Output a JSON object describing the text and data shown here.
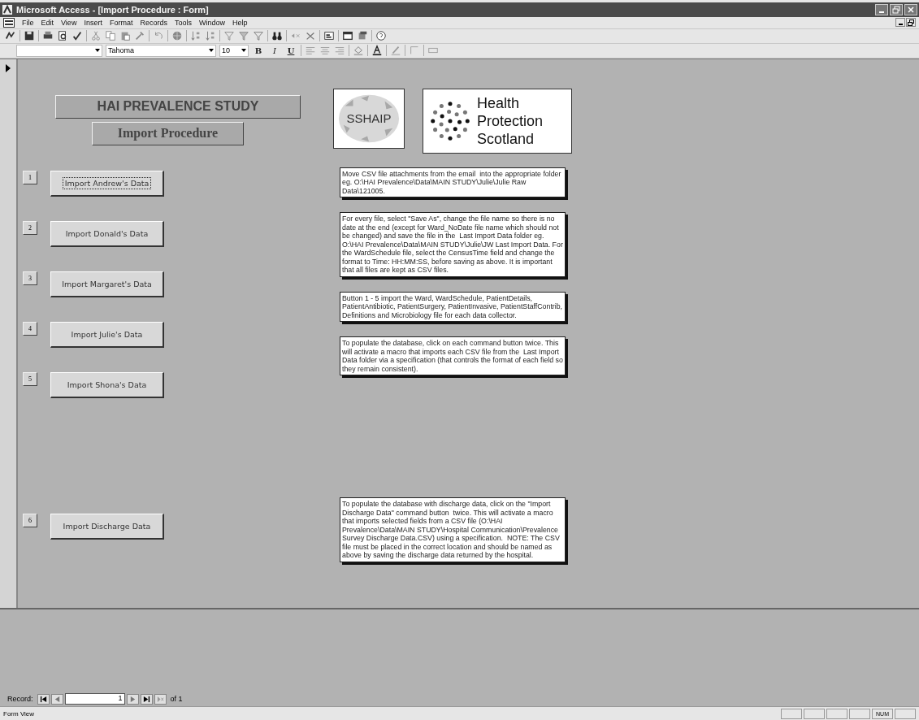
{
  "window": {
    "title": "Microsoft Access - [Import Procedure : Form]"
  },
  "menu": [
    {
      "label": "File"
    },
    {
      "label": "Edit"
    },
    {
      "label": "View"
    },
    {
      "label": "Insert"
    },
    {
      "label": "Format"
    },
    {
      "label": "Records"
    },
    {
      "label": "Tools"
    },
    {
      "label": "Window"
    },
    {
      "label": "Help"
    }
  ],
  "format_toolbar": {
    "font": "Tahoma",
    "size": "10",
    "bold": "B",
    "italic": "I",
    "underline": "U"
  },
  "form": {
    "heading": "HAI PREVALENCE STUDY",
    "subheading": "Import Procedure",
    "logos": [
      {
        "kind": "sshaip",
        "text": "SSHAIP"
      },
      {
        "kind": "hps",
        "lines": [
          "Health",
          "Protection",
          "Scotland"
        ]
      }
    ],
    "steps": [
      {
        "number": "1",
        "button": "Import Andrew's Data",
        "focused": true
      },
      {
        "number": "2",
        "button": "Import Donald's Data",
        "focused": false
      },
      {
        "number": "3",
        "button": "Import Margaret's Data",
        "focused": false
      },
      {
        "number": "4",
        "button": "Import Julie's Data",
        "focused": false
      },
      {
        "number": "5",
        "button": "Import Shona's Data",
        "focused": false
      },
      {
        "number": "6",
        "button": "Import Discharge Data",
        "focused": false
      }
    ],
    "notes": [
      "Move CSV file attachments from the email  into the appropriate folder eg. O:\\HAI Prevalence\\Data\\MAIN STUDY\\Julie\\Julie Raw Data\\121005.",
      "For every file, select \"Save As\", change the file name so there is no date at the end (except for Ward_NoDate file name which should not be changed) and save the file in the  Last Import Data folder eg. O:\\HAI Prevalence\\Data\\MAIN STUDY\\Julie\\JW Last Import Data. For the WardSchedule file, select the CensusTime field and change the format to Time: HH:MM:SS, before saving as above. It is important that all files are kept as CSV files.",
      "Button 1 - 5 import the Ward, WardSchedule, PatientDetails, PatientAntibiotic, PatientSurgery, PatientInvasive, PatientStaffContrib, Definitions and Microbiology file for each data collector.",
      "To populate the database, click on each command button twice. This will activate a macro that imports each CSV file from the  Last Import Data folder via a specification (that controls the format of each field so they remain consistent).",
      "To populate the database with discharge data, click on the \"Import Discharge Data\" command button  twice. This will activate a macro that imports selected fields from a CSV file (O:\\HAI Prevalence\\Data\\MAIN STUDY\\Hospital Communication\\Prevalence Survey Discharge Data.CSV) using a specification.  NOTE: The CSV file must be placed in the correct location and should be named as above by saving the discharge data returned by the hospital."
    ]
  },
  "record_nav": {
    "label": "Record:",
    "current": "1",
    "total": "of 1"
  },
  "status_bar": {
    "text": "Form View",
    "indicators": [
      "NUM"
    ]
  }
}
